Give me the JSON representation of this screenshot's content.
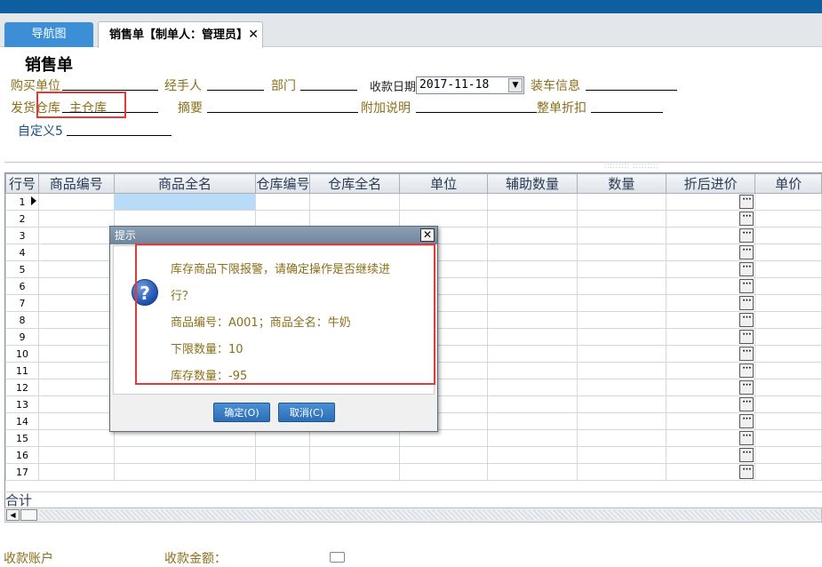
{
  "tabs": {
    "nav_label": "导航图",
    "active_label": "销售单【制单人：管理员】",
    "close_glyph": "✕"
  },
  "form": {
    "title": "销售单",
    "buyer_label": "购买单位",
    "handler_label": "经手人",
    "dept_label": "部门",
    "date_label": "收款日期",
    "date_value": "2017-11-18",
    "loading_label": "装车信息",
    "ship_label": "发货仓库",
    "ship_value": "主仓库",
    "summary_label": "摘要",
    "note_label": "附加说明",
    "discount_label": "整单折扣",
    "custom5_label": "自定义5"
  },
  "grid": {
    "headers": [
      "行号",
      "商品编号",
      "商品全名",
      "仓库编号",
      "仓库全名",
      "单位",
      "辅助数量",
      "数量",
      "折后进价",
      "单价"
    ],
    "rows": [
      "1",
      "2",
      "3",
      "4",
      "5",
      "6",
      "7",
      "8",
      "9",
      "10",
      "11",
      "12",
      "13",
      "14",
      "15",
      "16",
      "17"
    ],
    "total_label": "合计",
    "ellipsis": "···"
  },
  "bottom": {
    "account_label": "收款账户",
    "amount_label": "收款金额："
  },
  "dialog": {
    "title": "提示",
    "close": "✕",
    "icon": "?",
    "line1": "库存商品下限报警，请确定操作是否继续进",
    "line2": "行？",
    "line3": "商品编号：A001；商品全名：牛奶",
    "line4": "下限数量：10",
    "line5": "库存数量：-95",
    "ok": "确定(O)",
    "cancel": "取消(C)"
  },
  "colors": {
    "accent": "#0d5fa0",
    "label": "#8b6f1a",
    "highlight": "#e53935"
  }
}
